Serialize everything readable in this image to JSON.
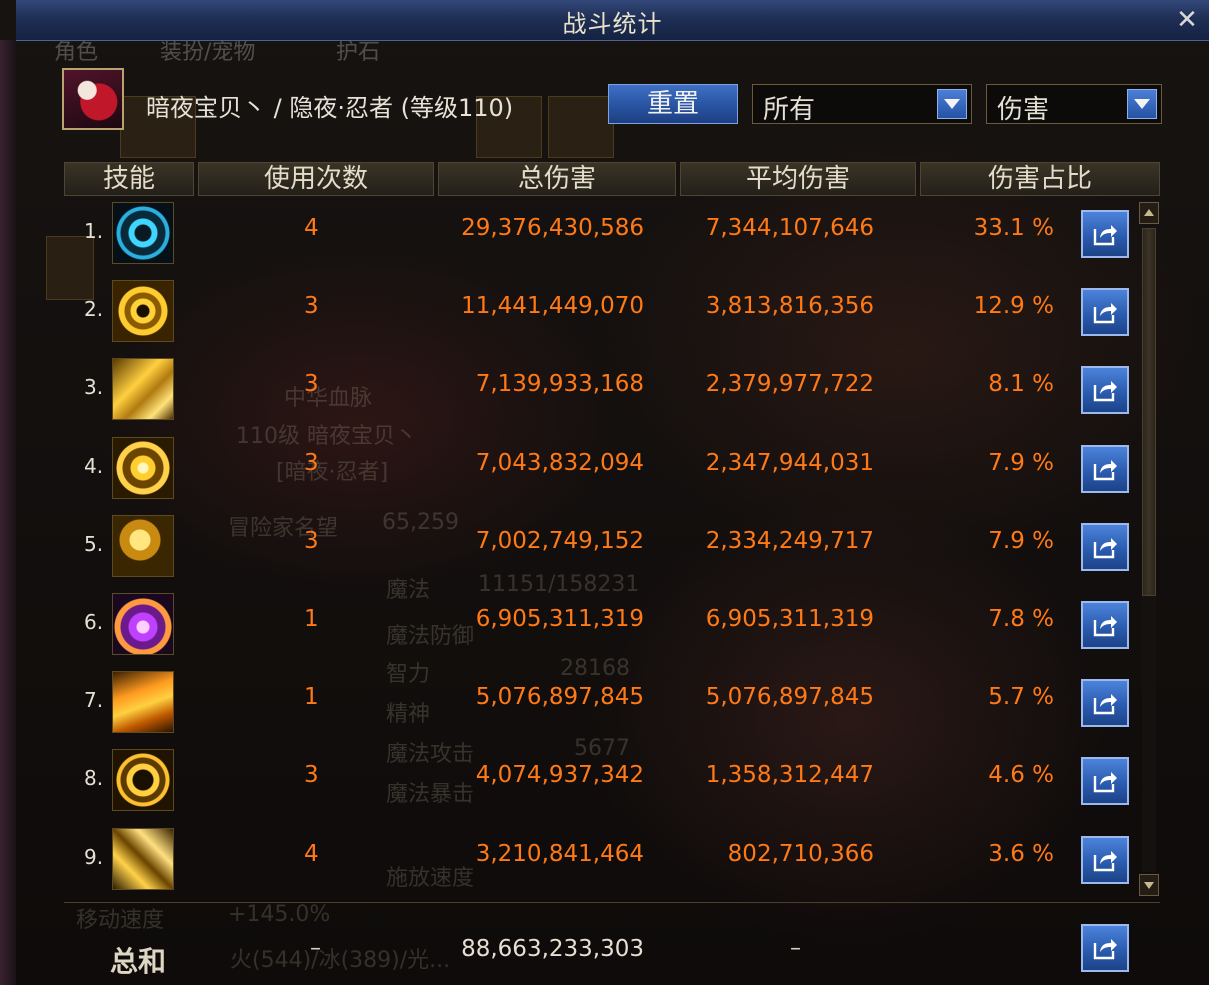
{
  "window": {
    "title": "战斗统计"
  },
  "background_tabs": [
    "角色",
    "装扮/宠物",
    "护石"
  ],
  "background_ghost_texts": [
    "冒险家名望",
    "65,259",
    "魔法",
    "11151/158231",
    "魔法防御",
    "智力",
    "28168",
    "精神",
    "魔法攻击",
    "5677",
    "魔法暴击",
    "施放速度",
    "移动速度",
    "+145.0%",
    "中华血脉",
    "110级 暗夜宝贝丶",
    "[暗夜·忍者]",
    "火(544)/冰(389)/光..."
  ],
  "character": {
    "label": "暗夜宝贝丶 / 隐夜·忍者 (等级110)"
  },
  "controls": {
    "reset_label": "重置",
    "filter_target": "所有",
    "filter_metric": "伤害"
  },
  "columns": [
    "技能",
    "使用次数",
    "总伤害",
    "平均伤害",
    "伤害占比"
  ],
  "rows": [
    {
      "rank": "1.",
      "uses": "4",
      "total": "29,376,430,586",
      "avg": "7,344,107,646",
      "pct": "33.1 %"
    },
    {
      "rank": "2.",
      "uses": "3",
      "total": "11,441,449,070",
      "avg": "3,813,816,356",
      "pct": "12.9 %"
    },
    {
      "rank": "3.",
      "uses": "3",
      "total": "7,139,933,168",
      "avg": "2,379,977,722",
      "pct": "8.1 %"
    },
    {
      "rank": "4.",
      "uses": "3",
      "total": "7,043,832,094",
      "avg": "2,347,944,031",
      "pct": "7.9 %"
    },
    {
      "rank": "5.",
      "uses": "3",
      "total": "7,002,749,152",
      "avg": "2,334,249,717",
      "pct": "7.9 %"
    },
    {
      "rank": "6.",
      "uses": "1",
      "total": "6,905,311,319",
      "avg": "6,905,311,319",
      "pct": "7.8 %"
    },
    {
      "rank": "7.",
      "uses": "1",
      "total": "5,076,897,845",
      "avg": "5,076,897,845",
      "pct": "5.7 %"
    },
    {
      "rank": "8.",
      "uses": "3",
      "total": "4,074,937,342",
      "avg": "1,358,312,447",
      "pct": "4.6 %"
    },
    {
      "rank": "9.",
      "uses": "4",
      "total": "3,210,841,464",
      "avg": "802,710,366",
      "pct": "3.6 %"
    }
  ],
  "totals": {
    "label": "总和",
    "uses": "–",
    "total": "88,663,233,303",
    "avg": "–"
  },
  "icons": [
    "close-icon",
    "chevron-down-icon",
    "share-icon",
    "scroll-up-icon",
    "scroll-down-icon",
    "skill-icon"
  ],
  "colors": {
    "value_text": "#ff7a16",
    "accent_blue": "#2b5cb0",
    "title_bar": "#1f2f55"
  }
}
